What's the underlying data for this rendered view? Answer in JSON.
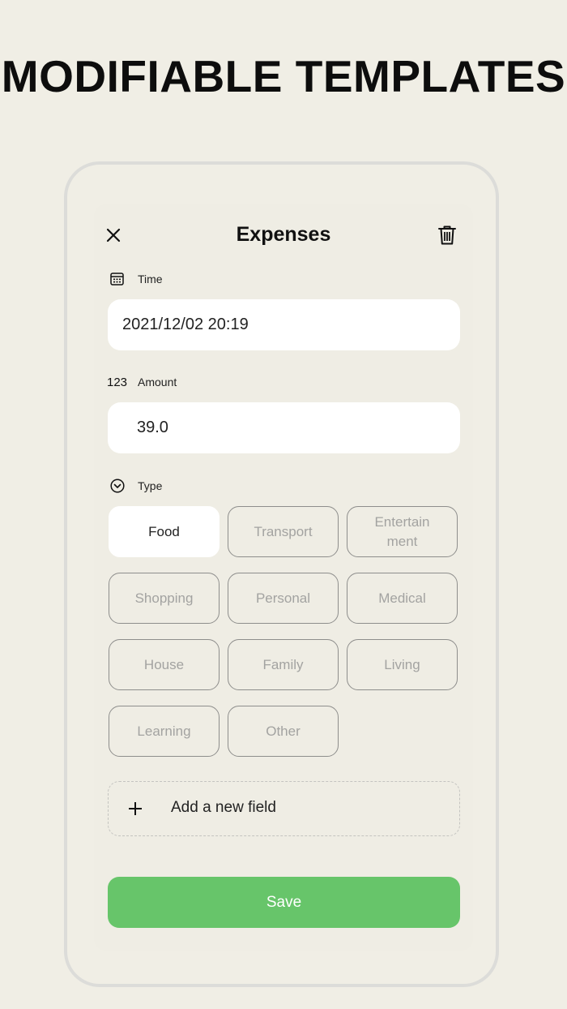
{
  "headline": "MODIFIABLE TEMPLATES",
  "header": {
    "title": "Expenses"
  },
  "time": {
    "label": "Time",
    "value": "2021/12/02 20:19"
  },
  "amount": {
    "label": "Amount",
    "icon_text": "123",
    "value": "39.0"
  },
  "type": {
    "label": "Type",
    "chips": [
      {
        "label": "Food",
        "selected": true
      },
      {
        "label": "Transport",
        "selected": false
      },
      {
        "label": "Entertain\nment",
        "selected": false
      },
      {
        "label": "Shopping",
        "selected": false
      },
      {
        "label": "Personal",
        "selected": false
      },
      {
        "label": "Medical",
        "selected": false
      },
      {
        "label": "House",
        "selected": false
      },
      {
        "label": "Family",
        "selected": false
      },
      {
        "label": "Living",
        "selected": false
      },
      {
        "label": "Learning",
        "selected": false
      },
      {
        "label": "Other",
        "selected": false
      }
    ]
  },
  "add_field": {
    "label": "Add a new field"
  },
  "save": {
    "label": "Save"
  },
  "colors": {
    "background": "#f0eee5",
    "save_button": "#67c56a",
    "input_background": "#ffffff",
    "chip_border": "#8e8e8c"
  },
  "icons": [
    "close-icon",
    "trash-icon",
    "calendar-icon",
    "chevron-circle-icon",
    "plus-icon"
  ]
}
